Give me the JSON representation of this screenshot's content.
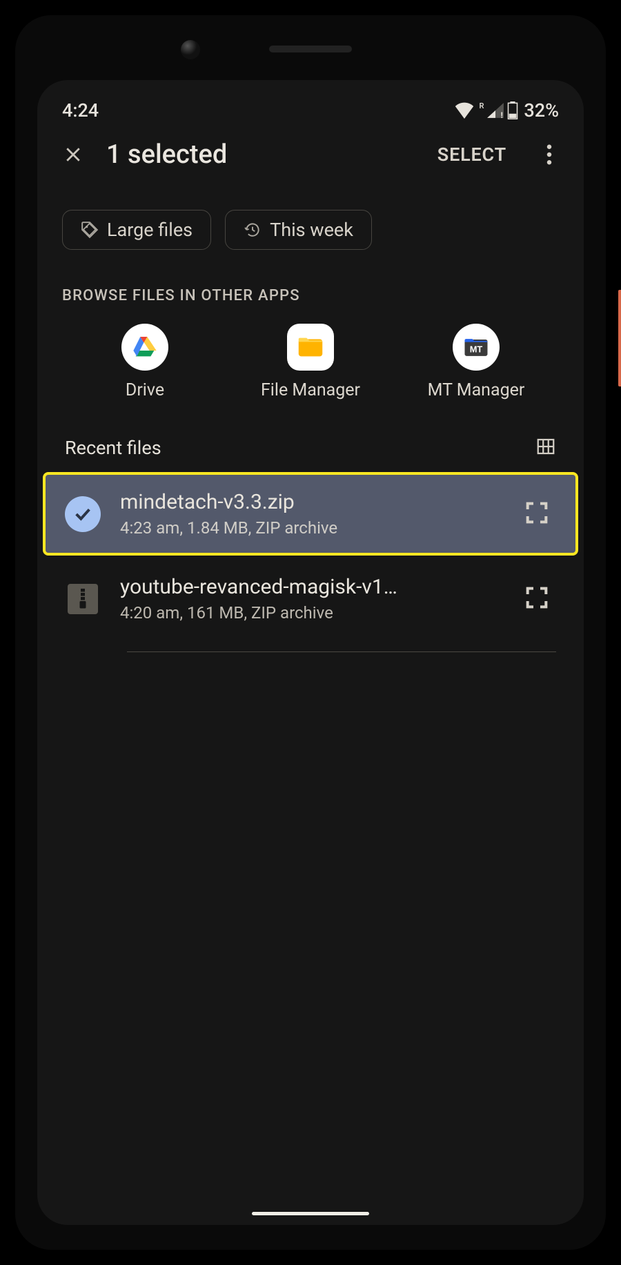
{
  "status": {
    "time": "4:24",
    "battery": "32%",
    "roaming": "R"
  },
  "appbar": {
    "title": "1 selected",
    "select": "SELECT"
  },
  "chips": {
    "large": "Large files",
    "thisweek": "This week"
  },
  "browse": {
    "label": "BROWSE FILES IN OTHER APPS"
  },
  "apps": {
    "drive": "Drive",
    "filemanager": "File Manager",
    "mtmanager": "MT Manager"
  },
  "recent": {
    "title": "Recent files"
  },
  "files": {
    "0": {
      "name": "mindetach-v3.3.zip",
      "meta": "4:23 am, 1.84 MB, ZIP archive"
    },
    "1": {
      "name": "youtube-revanced-magisk-v1…",
      "meta": "4:20 am, 161 MB, ZIP archive"
    }
  }
}
